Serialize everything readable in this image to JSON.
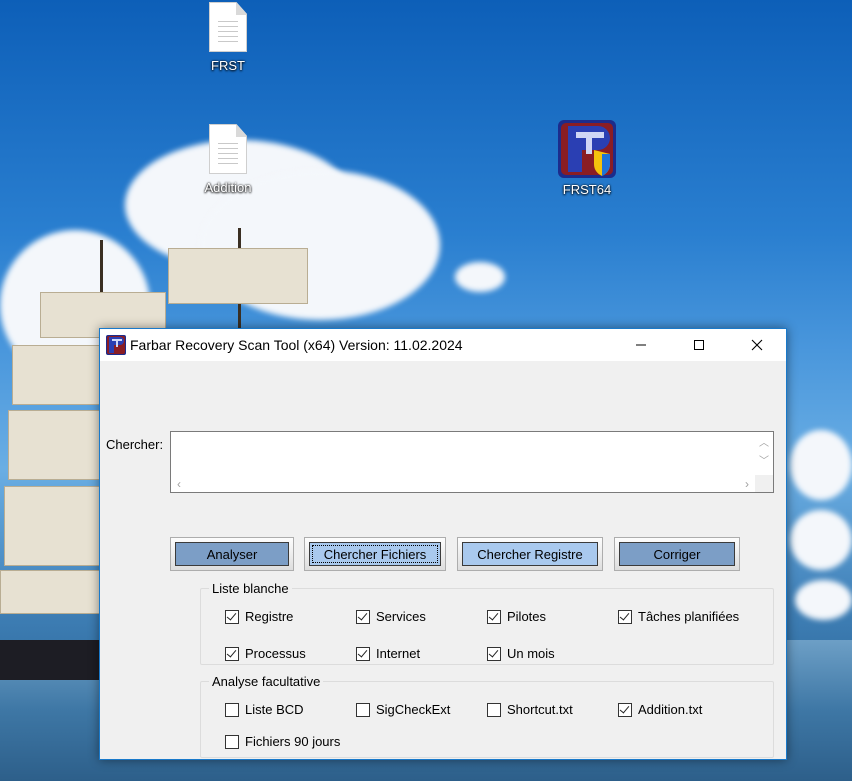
{
  "desktop": {
    "icons": [
      {
        "label": "FRST"
      },
      {
        "label": "Addition"
      },
      {
        "label": "FRST64"
      }
    ]
  },
  "window": {
    "title": "Farbar Recovery Scan Tool (x64) Version: 11.02.2024",
    "controls": {
      "minimize": "—",
      "maximize": "☐",
      "close": "✕"
    },
    "search": {
      "label": "Chercher:",
      "value": ""
    },
    "buttons": {
      "scan": "Analyser",
      "search_files": "Chercher Fichiers",
      "search_registry": "Chercher Registre",
      "fix": "Corriger"
    },
    "whitelist": {
      "legend": "Liste blanche",
      "items": [
        {
          "label": "Registre",
          "checked": true
        },
        {
          "label": "Services",
          "checked": true
        },
        {
          "label": "Pilotes",
          "checked": true
        },
        {
          "label": "Tâches planifiées",
          "checked": true
        },
        {
          "label": "Processus",
          "checked": true
        },
        {
          "label": "Internet",
          "checked": true
        },
        {
          "label": "Un mois",
          "checked": true
        }
      ]
    },
    "optional_scan": {
      "legend": "Analyse facultative",
      "items": [
        {
          "label": "Liste BCD",
          "checked": false
        },
        {
          "label": "SigCheckExt",
          "checked": false
        },
        {
          "label": "Shortcut.txt",
          "checked": false
        },
        {
          "label": "Addition.txt",
          "checked": true
        },
        {
          "label": "Fichiers 90 jours",
          "checked": false
        }
      ]
    }
  },
  "colors": {
    "title_border": "#1979ca",
    "button_dark": "#7c9ec6",
    "button_light": "#a9c9ee"
  }
}
